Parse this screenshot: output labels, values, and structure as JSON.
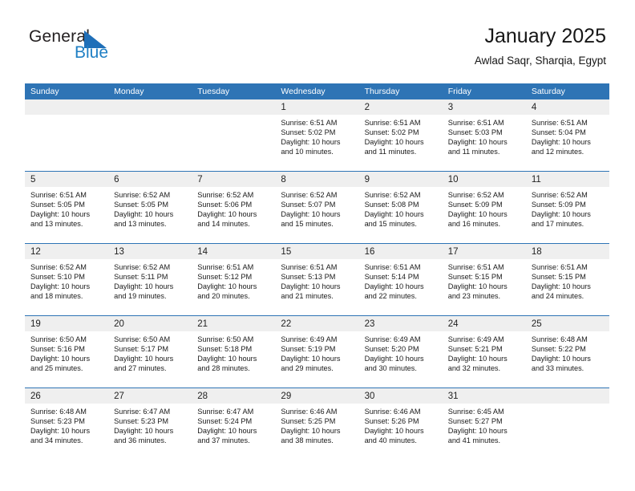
{
  "logo": {
    "word_one": "General",
    "word_two": "Blue",
    "triangle_icon": "triangle-icon",
    "blue": "#1f7fc4"
  },
  "header": {
    "title": "January 2025",
    "subtitle": "Awlad Saqr, Sharqia, Egypt"
  },
  "theme": {
    "header_blue": "#2e74b5",
    "band_gray": "#efefef",
    "text": "#1a1a1a"
  },
  "weekdays": [
    "Sunday",
    "Monday",
    "Tuesday",
    "Wednesday",
    "Thursday",
    "Friday",
    "Saturday"
  ],
  "weeks": [
    [
      {
        "day": "",
        "empty": true,
        "sunrise": "",
        "sunset": "",
        "daylight_1": "",
        "daylight_2": ""
      },
      {
        "day": "",
        "empty": true,
        "sunrise": "",
        "sunset": "",
        "daylight_1": "",
        "daylight_2": ""
      },
      {
        "day": "",
        "empty": true,
        "sunrise": "",
        "sunset": "",
        "daylight_1": "",
        "daylight_2": ""
      },
      {
        "day": "1",
        "empty": false,
        "sunrise": "Sunrise: 6:51 AM",
        "sunset": "Sunset: 5:02 PM",
        "daylight_1": "Daylight: 10 hours",
        "daylight_2": "and 10 minutes."
      },
      {
        "day": "2",
        "empty": false,
        "sunrise": "Sunrise: 6:51 AM",
        "sunset": "Sunset: 5:02 PM",
        "daylight_1": "Daylight: 10 hours",
        "daylight_2": "and 11 minutes."
      },
      {
        "day": "3",
        "empty": false,
        "sunrise": "Sunrise: 6:51 AM",
        "sunset": "Sunset: 5:03 PM",
        "daylight_1": "Daylight: 10 hours",
        "daylight_2": "and 11 minutes."
      },
      {
        "day": "4",
        "empty": false,
        "sunrise": "Sunrise: 6:51 AM",
        "sunset": "Sunset: 5:04 PM",
        "daylight_1": "Daylight: 10 hours",
        "daylight_2": "and 12 minutes."
      }
    ],
    [
      {
        "day": "5",
        "empty": false,
        "sunrise": "Sunrise: 6:51 AM",
        "sunset": "Sunset: 5:05 PM",
        "daylight_1": "Daylight: 10 hours",
        "daylight_2": "and 13 minutes."
      },
      {
        "day": "6",
        "empty": false,
        "sunrise": "Sunrise: 6:52 AM",
        "sunset": "Sunset: 5:05 PM",
        "daylight_1": "Daylight: 10 hours",
        "daylight_2": "and 13 minutes."
      },
      {
        "day": "7",
        "empty": false,
        "sunrise": "Sunrise: 6:52 AM",
        "sunset": "Sunset: 5:06 PM",
        "daylight_1": "Daylight: 10 hours",
        "daylight_2": "and 14 minutes."
      },
      {
        "day": "8",
        "empty": false,
        "sunrise": "Sunrise: 6:52 AM",
        "sunset": "Sunset: 5:07 PM",
        "daylight_1": "Daylight: 10 hours",
        "daylight_2": "and 15 minutes."
      },
      {
        "day": "9",
        "empty": false,
        "sunrise": "Sunrise: 6:52 AM",
        "sunset": "Sunset: 5:08 PM",
        "daylight_1": "Daylight: 10 hours",
        "daylight_2": "and 15 minutes."
      },
      {
        "day": "10",
        "empty": false,
        "sunrise": "Sunrise: 6:52 AM",
        "sunset": "Sunset: 5:09 PM",
        "daylight_1": "Daylight: 10 hours",
        "daylight_2": "and 16 minutes."
      },
      {
        "day": "11",
        "empty": false,
        "sunrise": "Sunrise: 6:52 AM",
        "sunset": "Sunset: 5:09 PM",
        "daylight_1": "Daylight: 10 hours",
        "daylight_2": "and 17 minutes."
      }
    ],
    [
      {
        "day": "12",
        "empty": false,
        "sunrise": "Sunrise: 6:52 AM",
        "sunset": "Sunset: 5:10 PM",
        "daylight_1": "Daylight: 10 hours",
        "daylight_2": "and 18 minutes."
      },
      {
        "day": "13",
        "empty": false,
        "sunrise": "Sunrise: 6:52 AM",
        "sunset": "Sunset: 5:11 PM",
        "daylight_1": "Daylight: 10 hours",
        "daylight_2": "and 19 minutes."
      },
      {
        "day": "14",
        "empty": false,
        "sunrise": "Sunrise: 6:51 AM",
        "sunset": "Sunset: 5:12 PM",
        "daylight_1": "Daylight: 10 hours",
        "daylight_2": "and 20 minutes."
      },
      {
        "day": "15",
        "empty": false,
        "sunrise": "Sunrise: 6:51 AM",
        "sunset": "Sunset: 5:13 PM",
        "daylight_1": "Daylight: 10 hours",
        "daylight_2": "and 21 minutes."
      },
      {
        "day": "16",
        "empty": false,
        "sunrise": "Sunrise: 6:51 AM",
        "sunset": "Sunset: 5:14 PM",
        "daylight_1": "Daylight: 10 hours",
        "daylight_2": "and 22 minutes."
      },
      {
        "day": "17",
        "empty": false,
        "sunrise": "Sunrise: 6:51 AM",
        "sunset": "Sunset: 5:15 PM",
        "daylight_1": "Daylight: 10 hours",
        "daylight_2": "and 23 minutes."
      },
      {
        "day": "18",
        "empty": false,
        "sunrise": "Sunrise: 6:51 AM",
        "sunset": "Sunset: 5:15 PM",
        "daylight_1": "Daylight: 10 hours",
        "daylight_2": "and 24 minutes."
      }
    ],
    [
      {
        "day": "19",
        "empty": false,
        "sunrise": "Sunrise: 6:50 AM",
        "sunset": "Sunset: 5:16 PM",
        "daylight_1": "Daylight: 10 hours",
        "daylight_2": "and 25 minutes."
      },
      {
        "day": "20",
        "empty": false,
        "sunrise": "Sunrise: 6:50 AM",
        "sunset": "Sunset: 5:17 PM",
        "daylight_1": "Daylight: 10 hours",
        "daylight_2": "and 27 minutes."
      },
      {
        "day": "21",
        "empty": false,
        "sunrise": "Sunrise: 6:50 AM",
        "sunset": "Sunset: 5:18 PM",
        "daylight_1": "Daylight: 10 hours",
        "daylight_2": "and 28 minutes."
      },
      {
        "day": "22",
        "empty": false,
        "sunrise": "Sunrise: 6:49 AM",
        "sunset": "Sunset: 5:19 PM",
        "daylight_1": "Daylight: 10 hours",
        "daylight_2": "and 29 minutes."
      },
      {
        "day": "23",
        "empty": false,
        "sunrise": "Sunrise: 6:49 AM",
        "sunset": "Sunset: 5:20 PM",
        "daylight_1": "Daylight: 10 hours",
        "daylight_2": "and 30 minutes."
      },
      {
        "day": "24",
        "empty": false,
        "sunrise": "Sunrise: 6:49 AM",
        "sunset": "Sunset: 5:21 PM",
        "daylight_1": "Daylight: 10 hours",
        "daylight_2": "and 32 minutes."
      },
      {
        "day": "25",
        "empty": false,
        "sunrise": "Sunrise: 6:48 AM",
        "sunset": "Sunset: 5:22 PM",
        "daylight_1": "Daylight: 10 hours",
        "daylight_2": "and 33 minutes."
      }
    ],
    [
      {
        "day": "26",
        "empty": false,
        "sunrise": "Sunrise: 6:48 AM",
        "sunset": "Sunset: 5:23 PM",
        "daylight_1": "Daylight: 10 hours",
        "daylight_2": "and 34 minutes."
      },
      {
        "day": "27",
        "empty": false,
        "sunrise": "Sunrise: 6:47 AM",
        "sunset": "Sunset: 5:23 PM",
        "daylight_1": "Daylight: 10 hours",
        "daylight_2": "and 36 minutes."
      },
      {
        "day": "28",
        "empty": false,
        "sunrise": "Sunrise: 6:47 AM",
        "sunset": "Sunset: 5:24 PM",
        "daylight_1": "Daylight: 10 hours",
        "daylight_2": "and 37 minutes."
      },
      {
        "day": "29",
        "empty": false,
        "sunrise": "Sunrise: 6:46 AM",
        "sunset": "Sunset: 5:25 PM",
        "daylight_1": "Daylight: 10 hours",
        "daylight_2": "and 38 minutes."
      },
      {
        "day": "30",
        "empty": false,
        "sunrise": "Sunrise: 6:46 AM",
        "sunset": "Sunset: 5:26 PM",
        "daylight_1": "Daylight: 10 hours",
        "daylight_2": "and 40 minutes."
      },
      {
        "day": "31",
        "empty": false,
        "sunrise": "Sunrise: 6:45 AM",
        "sunset": "Sunset: 5:27 PM",
        "daylight_1": "Daylight: 10 hours",
        "daylight_2": "and 41 minutes."
      },
      {
        "day": "",
        "empty": true,
        "sunrise": "",
        "sunset": "",
        "daylight_1": "",
        "daylight_2": ""
      }
    ]
  ]
}
